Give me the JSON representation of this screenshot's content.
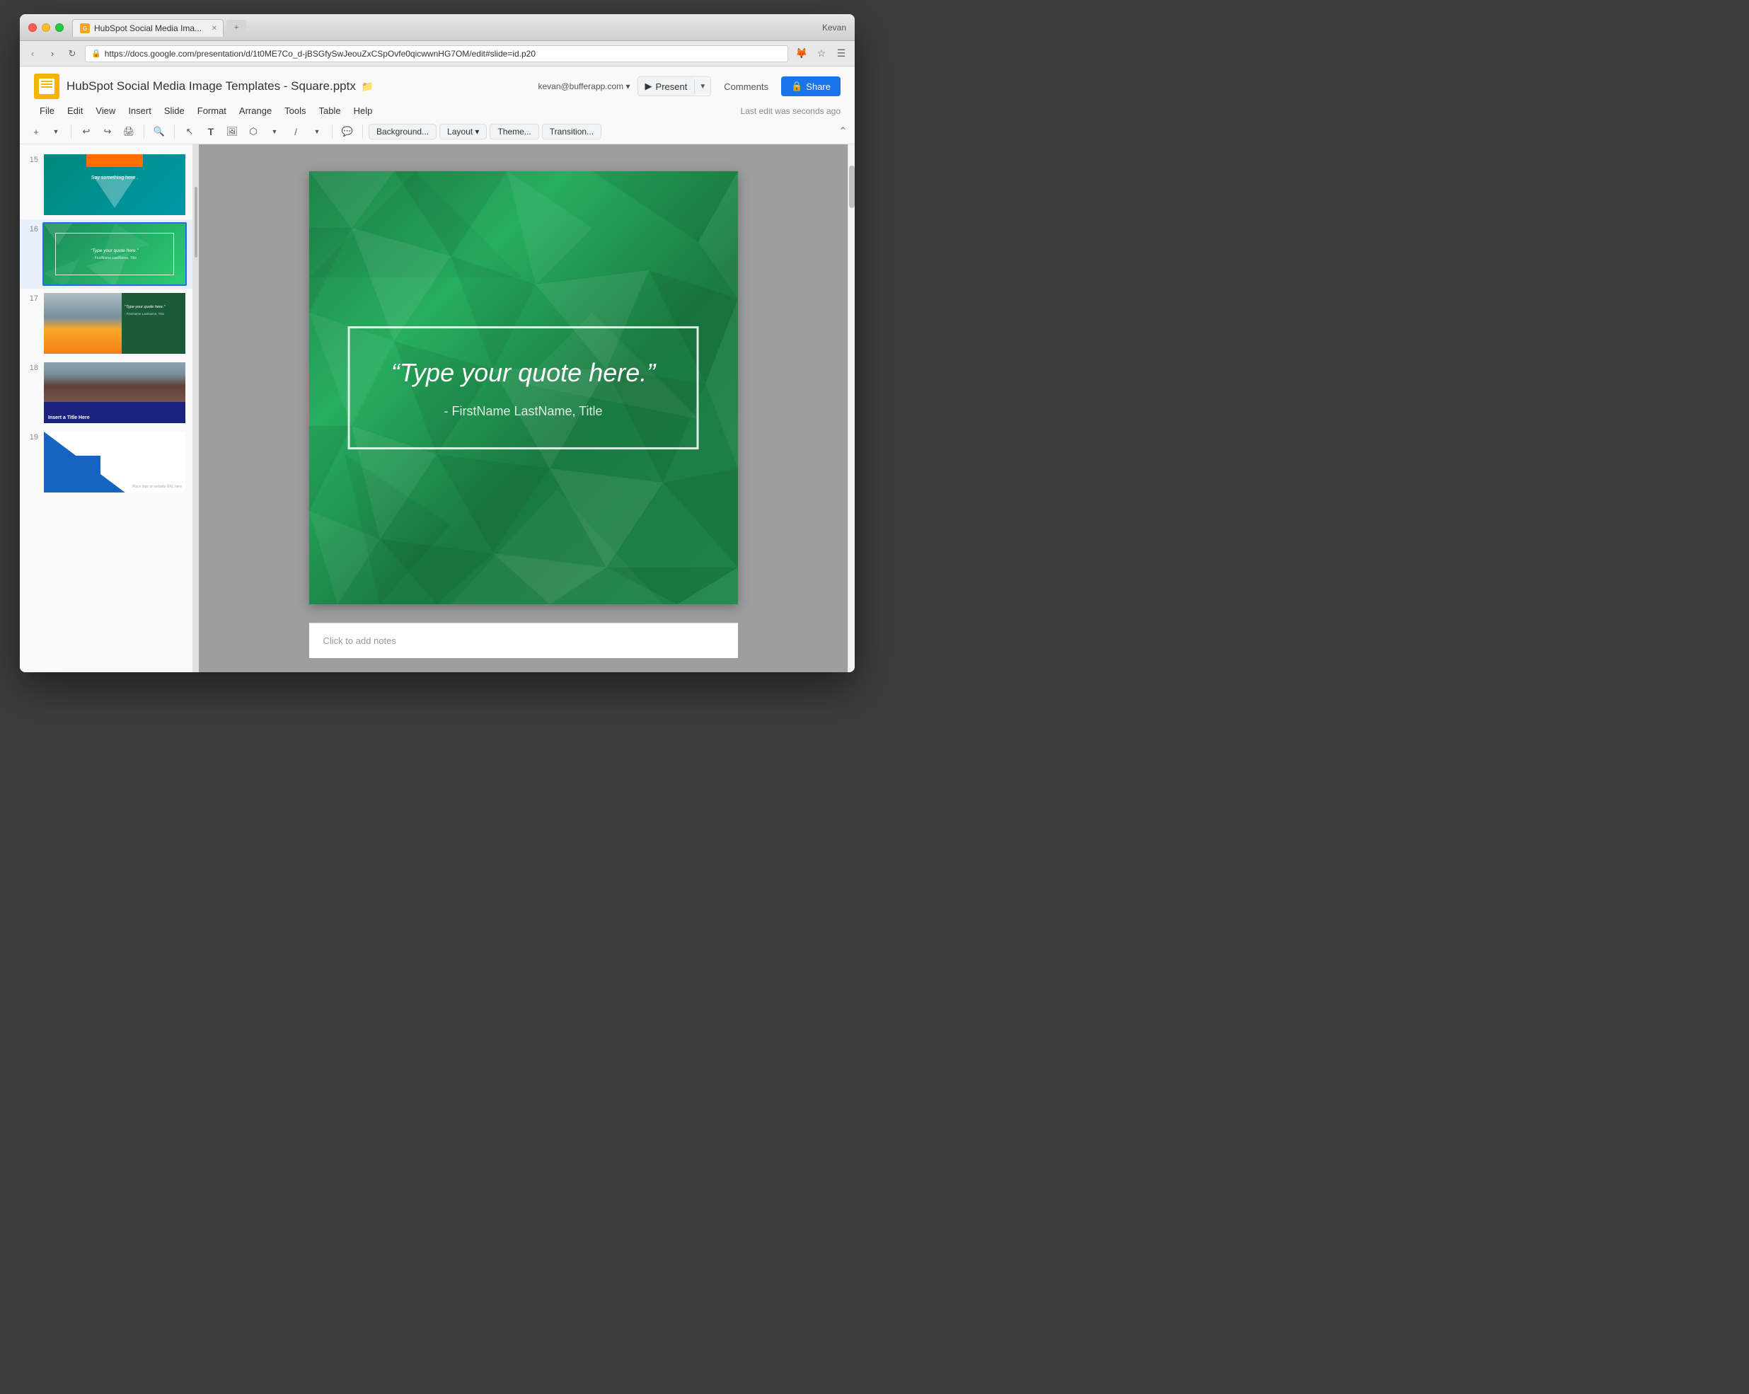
{
  "window": {
    "title": "HubSpot Social Media Image Templates - Square.pptx"
  },
  "browser": {
    "back_btn": "‹",
    "forward_btn": "›",
    "refresh": "↻",
    "url": "https://docs.google.com/presentation/d/1t0ME7Co_d-jBSGfySwJeouZxCSpOvfe0qicwwnHG7OM/edit#slide=id.p20",
    "tab_label": "HubSpot Social Media Ima...",
    "user": "Kevan"
  },
  "slides_app": {
    "logo_text": "G",
    "doc_title": "HubSpot Social Media Image Templates - Square.pptx",
    "user_email": "kevan@bufferapp.com ▾",
    "last_edit": "Last edit was seconds ago"
  },
  "menubar": {
    "items": [
      "File",
      "Edit",
      "View",
      "Insert",
      "Slide",
      "Format",
      "Arrange",
      "Tools",
      "Table",
      "Help"
    ]
  },
  "toolbar": {
    "slide_actions": [
      "Background...",
      "Layout ▾",
      "Theme...",
      "Transition..."
    ]
  },
  "slide_panel": {
    "slides": [
      {
        "number": "15",
        "id": "slide-15"
      },
      {
        "number": "16",
        "id": "slide-16"
      },
      {
        "number": "17",
        "id": "slide-17"
      },
      {
        "number": "18",
        "id": "slide-18"
      },
      {
        "number": "19",
        "id": "slide-19"
      }
    ]
  },
  "active_slide": {
    "quote_text": "“Type your quote here.”",
    "attribution": "- FirstName LastName, Title"
  },
  "slide_thumbnails": {
    "slide15": {
      "text": "Say something here ."
    },
    "slide16": {
      "quote": "\"Type your quote here.\"",
      "attribution": "- FirstName LastName, Title"
    },
    "slide17": {
      "quote": "\"Type your quote here.\"",
      "attribution": "- FirstName LastName, Title"
    },
    "slide18": {
      "title": "Insert a Title Here"
    }
  },
  "notes": {
    "placeholder": "Click to add notes"
  },
  "buttons": {
    "present": "Present",
    "comments": "Comments",
    "share": "Share"
  },
  "colors": {
    "accent_blue": "#1a73e8",
    "slide_green": "#1e8449",
    "share_blue": "#1a73e8",
    "navy": "#1a237e"
  }
}
